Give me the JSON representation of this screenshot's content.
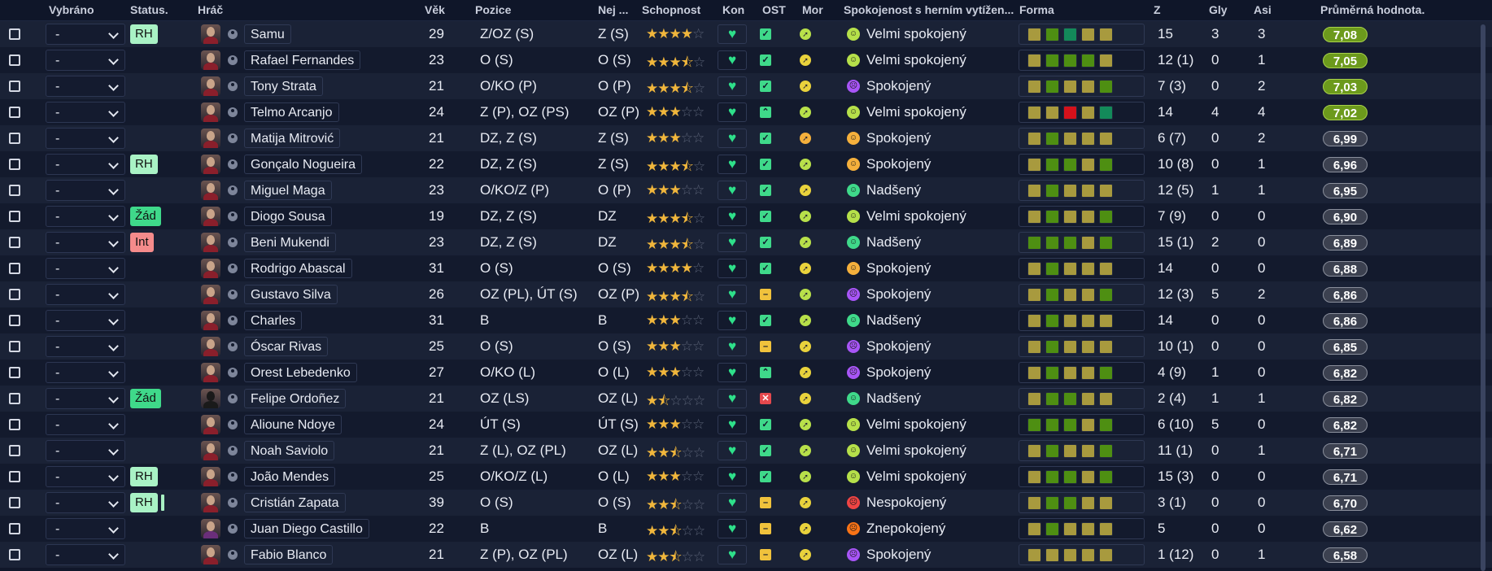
{
  "columns": {
    "selected": "Vybráno",
    "status": "Status.",
    "player": "Hráč",
    "age": "Věk",
    "position": "Pozice",
    "best": "Nej ...",
    "ability": "Schopnost",
    "kon": "Kon",
    "ost": "OST",
    "mor": "Mor",
    "satisfaction": "Spokojenost s herním vytížen...",
    "form": "Forma",
    "apps": "Z",
    "goals": "Gly",
    "assists": "Asi",
    "avg_rating": "Průměrná hodnota."
  },
  "select_value": "-",
  "colors": {
    "badge_rh": "#a9f2c5",
    "badge_zad": "#3fd98a",
    "badge_int": "#f58b8b",
    "form_yellow": "#a89a3e",
    "form_green": "#4e8f12",
    "form_teal": "#138a5a",
    "form_red": "#d5111b",
    "rating_top": "#6c9a1c",
    "rating_other": "#3c4150"
  },
  "rows": [
    {
      "badge": "RH",
      "name": "Samu",
      "age": "29",
      "pos": "Z/OZ (S)",
      "best": "Z (S)",
      "stars": 4,
      "ost": "check",
      "mor": "lime",
      "mood": "velmi",
      "satisfaction": "Velmi spokojený",
      "form": [
        "y",
        "g",
        "t",
        "y",
        "y"
      ],
      "apps": "15",
      "goals": "3",
      "assists": "3",
      "rating": "7,08",
      "top": true
    },
    {
      "badge": "",
      "name": "Rafael Fernandes",
      "age": "23",
      "pos": "O (S)",
      "best": "O (S)",
      "stars": 3.5,
      "ost": "check",
      "mor": "yellow",
      "mood": "velmi",
      "satisfaction": "Velmi spokojený",
      "form": [
        "y",
        "g",
        "g",
        "g",
        "y"
      ],
      "apps": "12 (1)",
      "goals": "0",
      "assists": "1",
      "rating": "7,05",
      "top": true
    },
    {
      "badge": "",
      "name": "Tony Strata",
      "age": "21",
      "pos": "O/KO (P)",
      "best": "O (P)",
      "stars": 3.5,
      "ost": "check",
      "mor": "yellow",
      "mood": "spok_p",
      "satisfaction": "Spokojený",
      "form": [
        "y",
        "g",
        "y",
        "y",
        "g"
      ],
      "apps": "7 (3)",
      "goals": "0",
      "assists": "2",
      "rating": "7,03",
      "top": true
    },
    {
      "badge": "",
      "name": "Telmo Arcanjo",
      "age": "24",
      "pos": "Z (P), OZ (PS)",
      "best": "OZ (P)",
      "stars": 3,
      "ost": "up",
      "mor": "lime",
      "mood": "velmi",
      "satisfaction": "Velmi spokojený",
      "form": [
        "y",
        "y",
        "r",
        "y",
        "t"
      ],
      "apps": "14",
      "goals": "4",
      "assists": "4",
      "rating": "7,02",
      "top": true
    },
    {
      "badge": "",
      "name": "Matija Mitrović",
      "age": "21",
      "pos": "DZ, Z (S)",
      "best": "Z (S)",
      "stars": 3,
      "ost": "check",
      "mor": "orange",
      "mood": "spok_o",
      "satisfaction": "Spokojený",
      "form": [
        "y",
        "g",
        "y",
        "y",
        "y"
      ],
      "apps": "6 (7)",
      "goals": "0",
      "assists": "2",
      "rating": "6,99",
      "top": false
    },
    {
      "badge": "RH",
      "name": "Gonçalo Nogueira",
      "age": "22",
      "pos": "DZ, Z (S)",
      "best": "Z (S)",
      "stars": 3.5,
      "ost": "check",
      "mor": "lime",
      "mood": "spok_o",
      "satisfaction": "Spokojený",
      "form": [
        "y",
        "g",
        "g",
        "y",
        "g"
      ],
      "apps": "10 (8)",
      "goals": "0",
      "assists": "1",
      "rating": "6,96",
      "top": false
    },
    {
      "badge": "",
      "name": "Miguel Maga",
      "age": "23",
      "pos": "O/KO/Z (P)",
      "best": "O (P)",
      "stars": 3,
      "ost": "check",
      "mor": "yellow",
      "mood": "nad",
      "satisfaction": "Nadšený",
      "form": [
        "y",
        "g",
        "y",
        "y",
        "y"
      ],
      "apps": "12 (5)",
      "goals": "1",
      "assists": "1",
      "rating": "6,95",
      "top": false
    },
    {
      "badge": "Žád",
      "name": "Diogo Sousa",
      "age": "19",
      "pos": "DZ, Z (S)",
      "best": "DZ",
      "stars": 3.5,
      "ost": "check",
      "mor": "lime",
      "mood": "velmi",
      "satisfaction": "Velmi spokojený",
      "form": [
        "y",
        "g",
        "y",
        "y",
        "g"
      ],
      "apps": "7 (9)",
      "goals": "0",
      "assists": "0",
      "rating": "6,90",
      "top": false
    },
    {
      "badge": "Int",
      "name": "Beni Mukendi",
      "age": "23",
      "pos": "DZ, Z (S)",
      "best": "DZ",
      "stars": 3.5,
      "ost": "check",
      "mor": "lime",
      "mood": "nad",
      "satisfaction": "Nadšený",
      "form": [
        "g",
        "g",
        "g",
        "y",
        "g"
      ],
      "apps": "15 (1)",
      "goals": "2",
      "assists": "0",
      "rating": "6,89",
      "top": false
    },
    {
      "badge": "",
      "name": "Rodrigo Abascal",
      "age": "31",
      "pos": "O (S)",
      "best": "O (S)",
      "stars": 4,
      "ost": "check",
      "mor": "yellow",
      "mood": "spok_o",
      "satisfaction": "Spokojený",
      "form": [
        "y",
        "g",
        "y",
        "y",
        "y"
      ],
      "apps": "14",
      "goals": "0",
      "assists": "0",
      "rating": "6,88",
      "top": false
    },
    {
      "badge": "",
      "name": "Gustavo Silva",
      "age": "26",
      "pos": "OZ (PL), ÚT (S)",
      "best": "OZ (P)",
      "stars": 3.5,
      "ost": "minus",
      "mor": "lime",
      "mood": "spok_p",
      "satisfaction": "Spokojený",
      "form": [
        "y",
        "g",
        "y",
        "y",
        "g"
      ],
      "apps": "12 (3)",
      "goals": "5",
      "assists": "2",
      "rating": "6,86",
      "top": false
    },
    {
      "badge": "",
      "name": "Charles",
      "age": "31",
      "pos": "B",
      "best": "B",
      "stars": 3,
      "ost": "check",
      "mor": "lime",
      "mood": "nad",
      "satisfaction": "Nadšený",
      "form": [
        "y",
        "g",
        "y",
        "y",
        "y"
      ],
      "apps": "14",
      "goals": "0",
      "assists": "0",
      "rating": "6,86",
      "top": false
    },
    {
      "badge": "",
      "name": "Óscar Rivas",
      "age": "25",
      "pos": "O (S)",
      "best": "O (S)",
      "stars": 3,
      "ost": "minus",
      "mor": "yellow",
      "mood": "spok_p",
      "satisfaction": "Spokojený",
      "form": [
        "y",
        "g",
        "y",
        "y",
        "y"
      ],
      "apps": "10 (1)",
      "goals": "0",
      "assists": "0",
      "rating": "6,85",
      "top": false
    },
    {
      "badge": "",
      "name": "Orest Lebedenko",
      "age": "27",
      "pos": "O/KO (L)",
      "best": "O (L)",
      "stars": 3,
      "ost": "up",
      "mor": "yellow",
      "mood": "spok_p",
      "satisfaction": "Spokojený",
      "form": [
        "y",
        "g",
        "y",
        "y",
        "g"
      ],
      "apps": "4 (9)",
      "goals": "1",
      "assists": "0",
      "rating": "6,82",
      "top": false
    },
    {
      "badge": "Žád",
      "name": "Felipe Ordoñez",
      "age": "21",
      "pos": "OZ (LS)",
      "best": "OZ (L)",
      "stars": 1.5,
      "ost": "x",
      "mor": "yellow",
      "mood": "nad",
      "satisfaction": "Nadšený",
      "form": [
        "y",
        "g",
        "g",
        "y",
        "y"
      ],
      "apps": "2 (4)",
      "goals": "1",
      "assists": "1",
      "rating": "6,82",
      "top": false,
      "dark": true
    },
    {
      "badge": "",
      "name": "Alioune Ndoye",
      "age": "24",
      "pos": "ÚT (S)",
      "best": "ÚT (S)",
      "stars": 3,
      "ost": "check",
      "mor": "lime",
      "mood": "velmi",
      "satisfaction": "Velmi spokojený",
      "form": [
        "g",
        "g",
        "g",
        "y",
        "g"
      ],
      "apps": "6 (10)",
      "goals": "5",
      "assists": "0",
      "rating": "6,82",
      "top": false
    },
    {
      "badge": "",
      "name": "Noah Saviolo",
      "age": "21",
      "pos": "Z (L), OZ (PL)",
      "best": "OZ (L)",
      "stars": 2.5,
      "ost": "check",
      "mor": "lime",
      "mood": "velmi",
      "satisfaction": "Velmi spokojený",
      "form": [
        "y",
        "g",
        "y",
        "y",
        "g"
      ],
      "apps": "11 (1)",
      "goals": "0",
      "assists": "1",
      "rating": "6,71",
      "top": false
    },
    {
      "badge": "RH",
      "name": "João Mendes",
      "age": "25",
      "pos": "O/KO/Z (L)",
      "best": "O (L)",
      "stars": 3,
      "ost": "check",
      "mor": "lime",
      "mood": "velmi",
      "satisfaction": "Velmi spokojený",
      "form": [
        "y",
        "g",
        "g",
        "y",
        "g"
      ],
      "apps": "15 (3)",
      "goals": "0",
      "assists": "0",
      "rating": "6,71",
      "top": false
    },
    {
      "badge": "RH",
      "name": "Cristián Zapata",
      "age": "39",
      "pos": "O (S)",
      "best": "O (S)",
      "stars": 2.5,
      "ost": "minus",
      "mor": "yellow",
      "mood": "nesp",
      "satisfaction": "Nespokojený",
      "form": [
        "y",
        "g",
        "g",
        "y",
        "y"
      ],
      "apps": "3 (1)",
      "goals": "0",
      "assists": "0",
      "rating": "6,70",
      "top": false,
      "pipe": true
    },
    {
      "badge": "",
      "name": "Juan Diego Castillo",
      "age": "22",
      "pos": "B",
      "best": "B",
      "stars": 2.5,
      "ost": "minus",
      "mor": "yellow",
      "mood": "znep",
      "satisfaction": "Znepokojený",
      "form": [
        "y",
        "g",
        "y",
        "y",
        "y"
      ],
      "apps": "5",
      "goals": "0",
      "assists": "0",
      "rating": "6,62",
      "top": false,
      "alt": true
    },
    {
      "badge": "",
      "name": "Fabio Blanco",
      "age": "21",
      "pos": "Z (P), OZ (PL)",
      "best": "OZ (L)",
      "stars": 2.5,
      "ost": "minus",
      "mor": "yellow",
      "mood": "spok_p",
      "satisfaction": "Spokojený",
      "form": [
        "y",
        "y",
        "y",
        "y",
        "y"
      ],
      "apps": "1 (12)",
      "goals": "0",
      "assists": "1",
      "rating": "6,58",
      "top": false
    }
  ]
}
